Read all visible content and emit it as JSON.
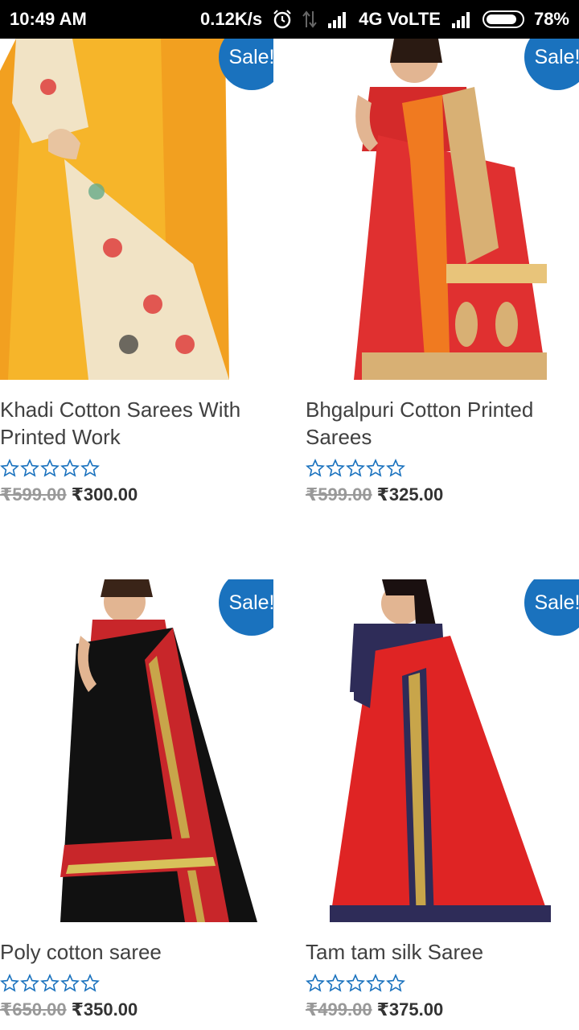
{
  "status_bar": {
    "time": "10:49 AM",
    "net_speed": "0.12K/s",
    "network": "4G VoLTE",
    "battery": "78%"
  },
  "sale_badge": "Sale!",
  "products": [
    {
      "title": "Khadi Cotton Sarees With Printed Work",
      "old_price": "₹599.00",
      "price": "₹300.00"
    },
    {
      "title": "Bhgalpuri Cotton Printed Sarees",
      "old_price": "₹599.00",
      "price": "₹325.00"
    },
    {
      "title": "Poly cotton saree",
      "old_price": "₹650.00",
      "price": "₹350.00"
    },
    {
      "title": "Tam tam silk Saree",
      "old_price": "₹499.00",
      "price": "₹375.00"
    }
  ],
  "colors": {
    "sale_badge": "#1a72be",
    "star_outline": "#1a72be"
  }
}
